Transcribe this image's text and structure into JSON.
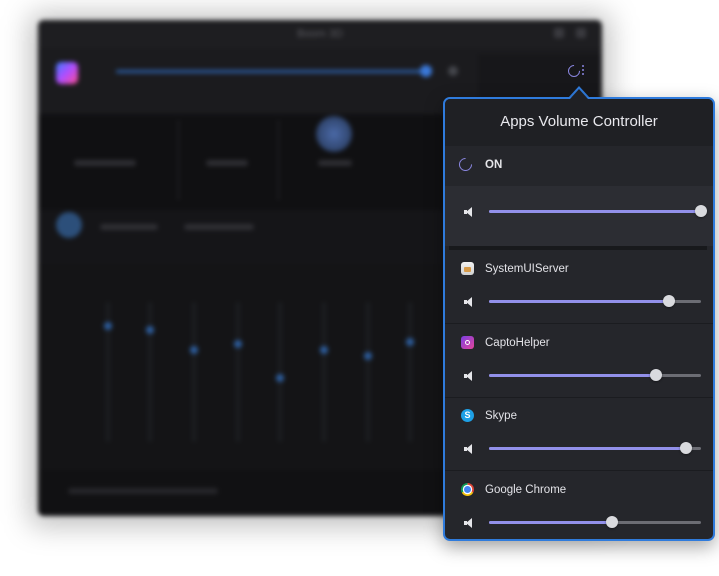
{
  "background_app": {
    "window_title": "Boom 3D"
  },
  "popover": {
    "title": "Apps Volume Controller",
    "on_label": "ON",
    "master_volume": 1.0,
    "accent_color": "#2f7bdc",
    "slider_fill_color": "#9290ea",
    "apps": [
      {
        "name": "SystemUIServer",
        "icon": "systemuiserver-icon",
        "volume": 0.85
      },
      {
        "name": "CaptoHelper",
        "icon": "captohelper-icon",
        "volume": 0.79
      },
      {
        "name": "Skype",
        "icon": "skype-icon",
        "volume": 0.93
      },
      {
        "name": "Google Chrome",
        "icon": "google-chrome-icon",
        "volume": 0.58
      }
    ]
  }
}
